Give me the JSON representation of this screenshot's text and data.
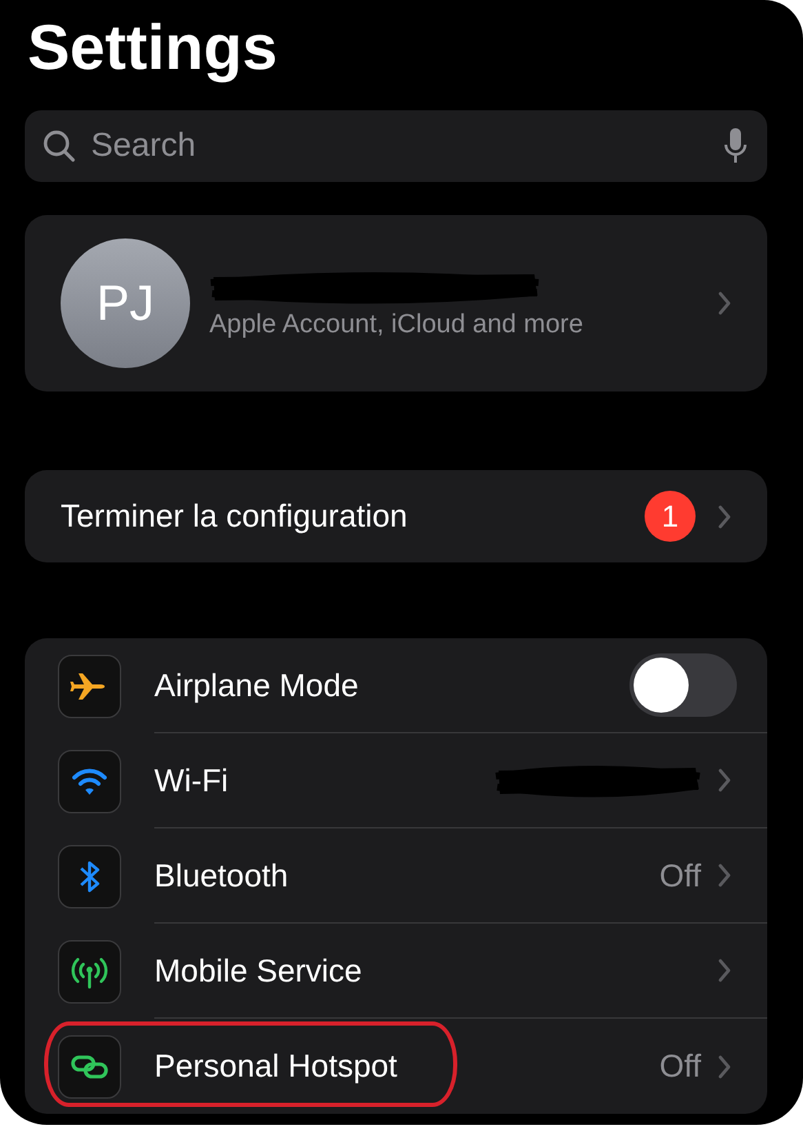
{
  "title": "Settings",
  "search": {
    "placeholder": "Search"
  },
  "account": {
    "initials": "PJ",
    "name_redacted": true,
    "subtitle": "Apple Account, iCloud and more"
  },
  "setup": {
    "label": "Terminer la configuration",
    "badge": "1"
  },
  "rows": [
    {
      "kind": "toggle",
      "label": "Airplane Mode",
      "on": false,
      "highlighted": false
    },
    {
      "kind": "link",
      "label": "Wi-Fi",
      "value_redacted": true,
      "highlighted": false
    },
    {
      "kind": "link",
      "label": "Bluetooth",
      "value": "Off",
      "highlighted": false
    },
    {
      "kind": "link",
      "label": "Mobile Service",
      "highlighted": false
    },
    {
      "kind": "link",
      "label": "Personal Hotspot",
      "value": "Off",
      "highlighted": true
    }
  ]
}
